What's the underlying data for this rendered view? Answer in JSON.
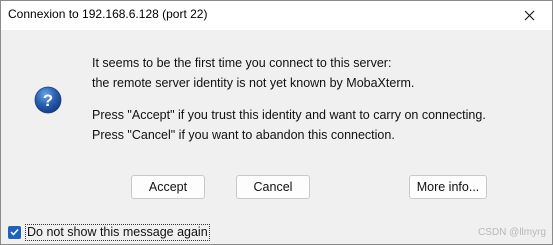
{
  "window": {
    "title": "Connexion to 192.168.6.128 (port 22)",
    "close_icon": "close-icon"
  },
  "message": {
    "line1": "It seems to be the first time you connect to this server:",
    "line2": "the remote server identity is not yet known by MobaXterm.",
    "line3": "Press \"Accept\" if you trust this identity and want to carry on connecting.",
    "line4": "Press \"Cancel\" if you want to abandon this connection."
  },
  "icon": "question-icon",
  "buttons": {
    "accept": "Accept",
    "cancel": "Cancel",
    "more_info": "More info..."
  },
  "checkbox": {
    "label": "Do not show this message again",
    "checked": true
  },
  "watermark": "CSDN @llmyrg",
  "colors": {
    "accent": "#1f63b8",
    "dialog_bg": "#f0f0f0"
  }
}
